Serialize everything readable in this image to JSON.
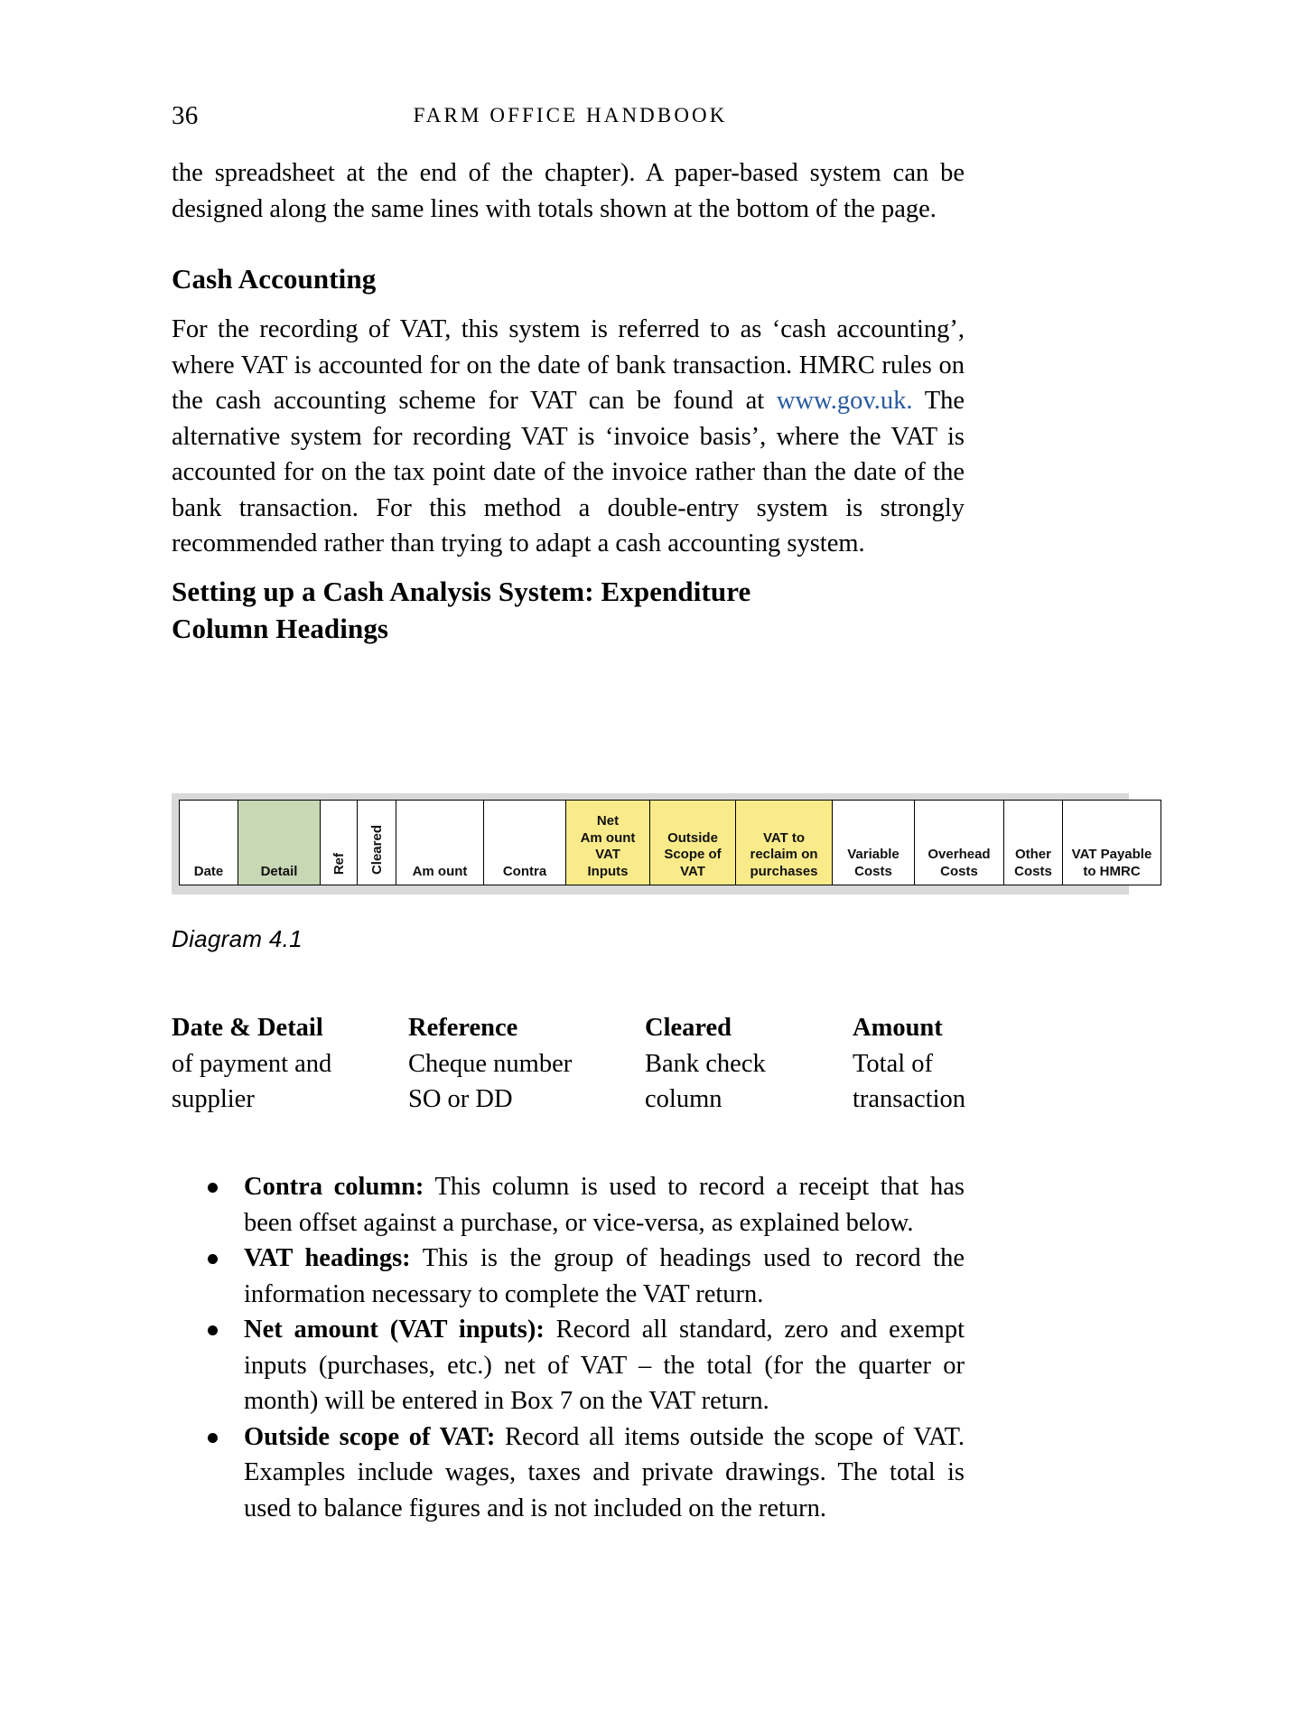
{
  "page": {
    "folio": "36",
    "running_head": "FARM OFFICE HANDBOOK"
  },
  "intro_paragraph": "the spreadsheet at the end of the chapter). A paper-based system can be designed along the same lines with totals shown at the bottom of the page.",
  "cash_accounting": {
    "heading": "Cash Accounting",
    "paragraph_before_link": "For the recording of VAT, this system is referred to as ‘cash accounting’, where VAT is accounted for on the date of bank transaction. HMRC rules on the cash accounting scheme for VAT can be found at ",
    "link_text": "www.gov.uk.",
    "link_color": "#2a5a9e",
    "paragraph_after_link": " The alternative system for recording VAT is ‘invoice basis’, where the VAT is accounted for on the tax point date of the invoice rather than the date of the bank transaction. For this method a double-entry system is strongly recommended rather than trying to adapt a cash accounting system."
  },
  "setup_section": {
    "heading_line1": "Setting up a Cash Analysis System: Expenditure",
    "heading_line2": "Column Headings"
  },
  "diagram": {
    "caption": "Diagram 4.1",
    "frame_color": "#d9d9d9",
    "green_color": "#c8d7b4",
    "yellow_color": "#faeb8a",
    "columns": [
      {
        "label": "Date",
        "lines": [
          "Date"
        ],
        "fill": "white",
        "rotated": false
      },
      {
        "label": "Detail",
        "lines": [
          "Detail"
        ],
        "fill": "green",
        "rotated": false
      },
      {
        "label": "Ref",
        "lines": [
          "Ref"
        ],
        "fill": "white",
        "rotated": true
      },
      {
        "label": "Cleared",
        "lines": [
          "Cleared"
        ],
        "fill": "white",
        "rotated": true
      },
      {
        "label": "Amount",
        "lines": [
          "Am ount"
        ],
        "fill": "white",
        "rotated": false
      },
      {
        "label": "Contra",
        "lines": [
          "Contra"
        ],
        "fill": "white",
        "rotated": false
      },
      {
        "label": "Net Amount VAT Inputs",
        "lines": [
          "Net",
          "Am ount",
          "VAT",
          "Inputs"
        ],
        "fill": "yellow",
        "rotated": false
      },
      {
        "label": "Outside Scope of VAT",
        "lines": [
          "Outside",
          "Scope of",
          "VAT"
        ],
        "fill": "yellow",
        "rotated": false
      },
      {
        "label": "VAT to reclaim on purchases",
        "lines": [
          "VAT to",
          "reclaim on",
          "purchases"
        ],
        "fill": "yellow",
        "rotated": false
      },
      {
        "label": "Variable Costs",
        "lines": [
          "Variable",
          "Costs"
        ],
        "fill": "white",
        "rotated": false
      },
      {
        "label": "Overhead Costs",
        "lines": [
          "Overhead",
          "Costs"
        ],
        "fill": "white",
        "rotated": false
      },
      {
        "label": "Other Costs",
        "lines": [
          "Other",
          "Costs"
        ],
        "fill": "white",
        "rotated": false
      },
      {
        "label": "VAT Payable to HMRC",
        "lines": [
          "VAT Payable",
          "to HMRC"
        ],
        "fill": "white",
        "rotated": false
      }
    ]
  },
  "definitions": [
    {
      "head": "Date & Detail",
      "lines": [
        "of payment and",
        "supplier"
      ]
    },
    {
      "head": "Reference",
      "lines": [
        "Cheque number",
        "SO or DD"
      ]
    },
    {
      "head": "Cleared",
      "lines": [
        "Bank check",
        "column"
      ]
    },
    {
      "head": "Amount",
      "lines": [
        "Total of",
        "transaction"
      ]
    }
  ],
  "bullets": [
    {
      "lead": "Contra column:",
      "text": " This column is used to record a receipt that has been offset against a purchase, or vice-versa, as explained below."
    },
    {
      "lead": "VAT headings:",
      "text": " This is the group of headings used to record the information necessary to complete the VAT return."
    },
    {
      "lead": "Net amount (VAT inputs):",
      "text": " Record all standard, zero and exempt inputs (purchases, etc.) net of VAT – the total (for the quarter or month) will be entered in Box 7 on the VAT return."
    },
    {
      "lead": "Outside scope of VAT:",
      "text": " Record all items outside the scope of VAT. Examples include wages, taxes and private drawings. The total is used to balance figures and is not included on the return."
    }
  ]
}
